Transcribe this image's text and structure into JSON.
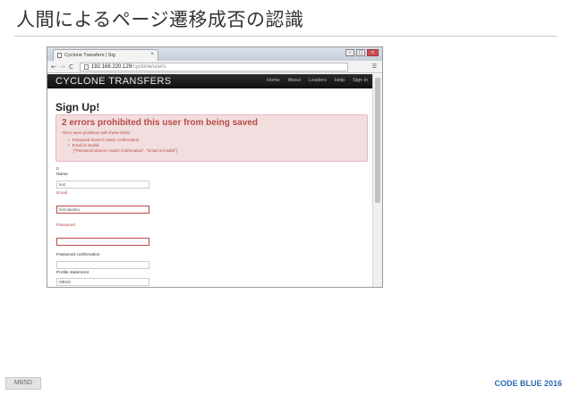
{
  "slide": {
    "title": "人間によるページ遷移成否の認識",
    "footer_left": "MBSD",
    "footer_right": "CODE BLUE 2016"
  },
  "browser": {
    "tab_title": "Cyclone Transfers | Sig",
    "tab_close": "×",
    "url_host": "192.168.220.129",
    "url_path": "/cyclone/users",
    "toolbar_right": "☰"
  },
  "site": {
    "brand": "CYCLONE TRANSFERS",
    "nav": [
      "Home",
      "About",
      "Leaders",
      "Help",
      "Sign in"
    ]
  },
  "page": {
    "heading": "Sign Up!",
    "alert": {
      "title": "2 errors prohibited this user from being saved",
      "subtitle": "There were problems with these fields:",
      "items": [
        "Password doesn't match confirmation",
        "Email is invalid"
      ],
      "raw": "[\"Password doesn't match confirmation\", \"Email is invalid\"]"
    },
    "form": {
      "marker": "0",
      "name_label": "Name",
      "name_value": "test",
      "email_label": "Email",
      "email_value": "test.takatsu",
      "password_label": "Password",
      "password_value": "",
      "password_confirmation_label": "Password confirmation",
      "password_confirmation_value": "",
      "profile_label": "Profile statement",
      "profile_value": "MBSD"
    }
  },
  "colors": {
    "error": "#b94a48",
    "alert_bg": "#f2dede",
    "footer_brand": "#2b6cb3"
  }
}
